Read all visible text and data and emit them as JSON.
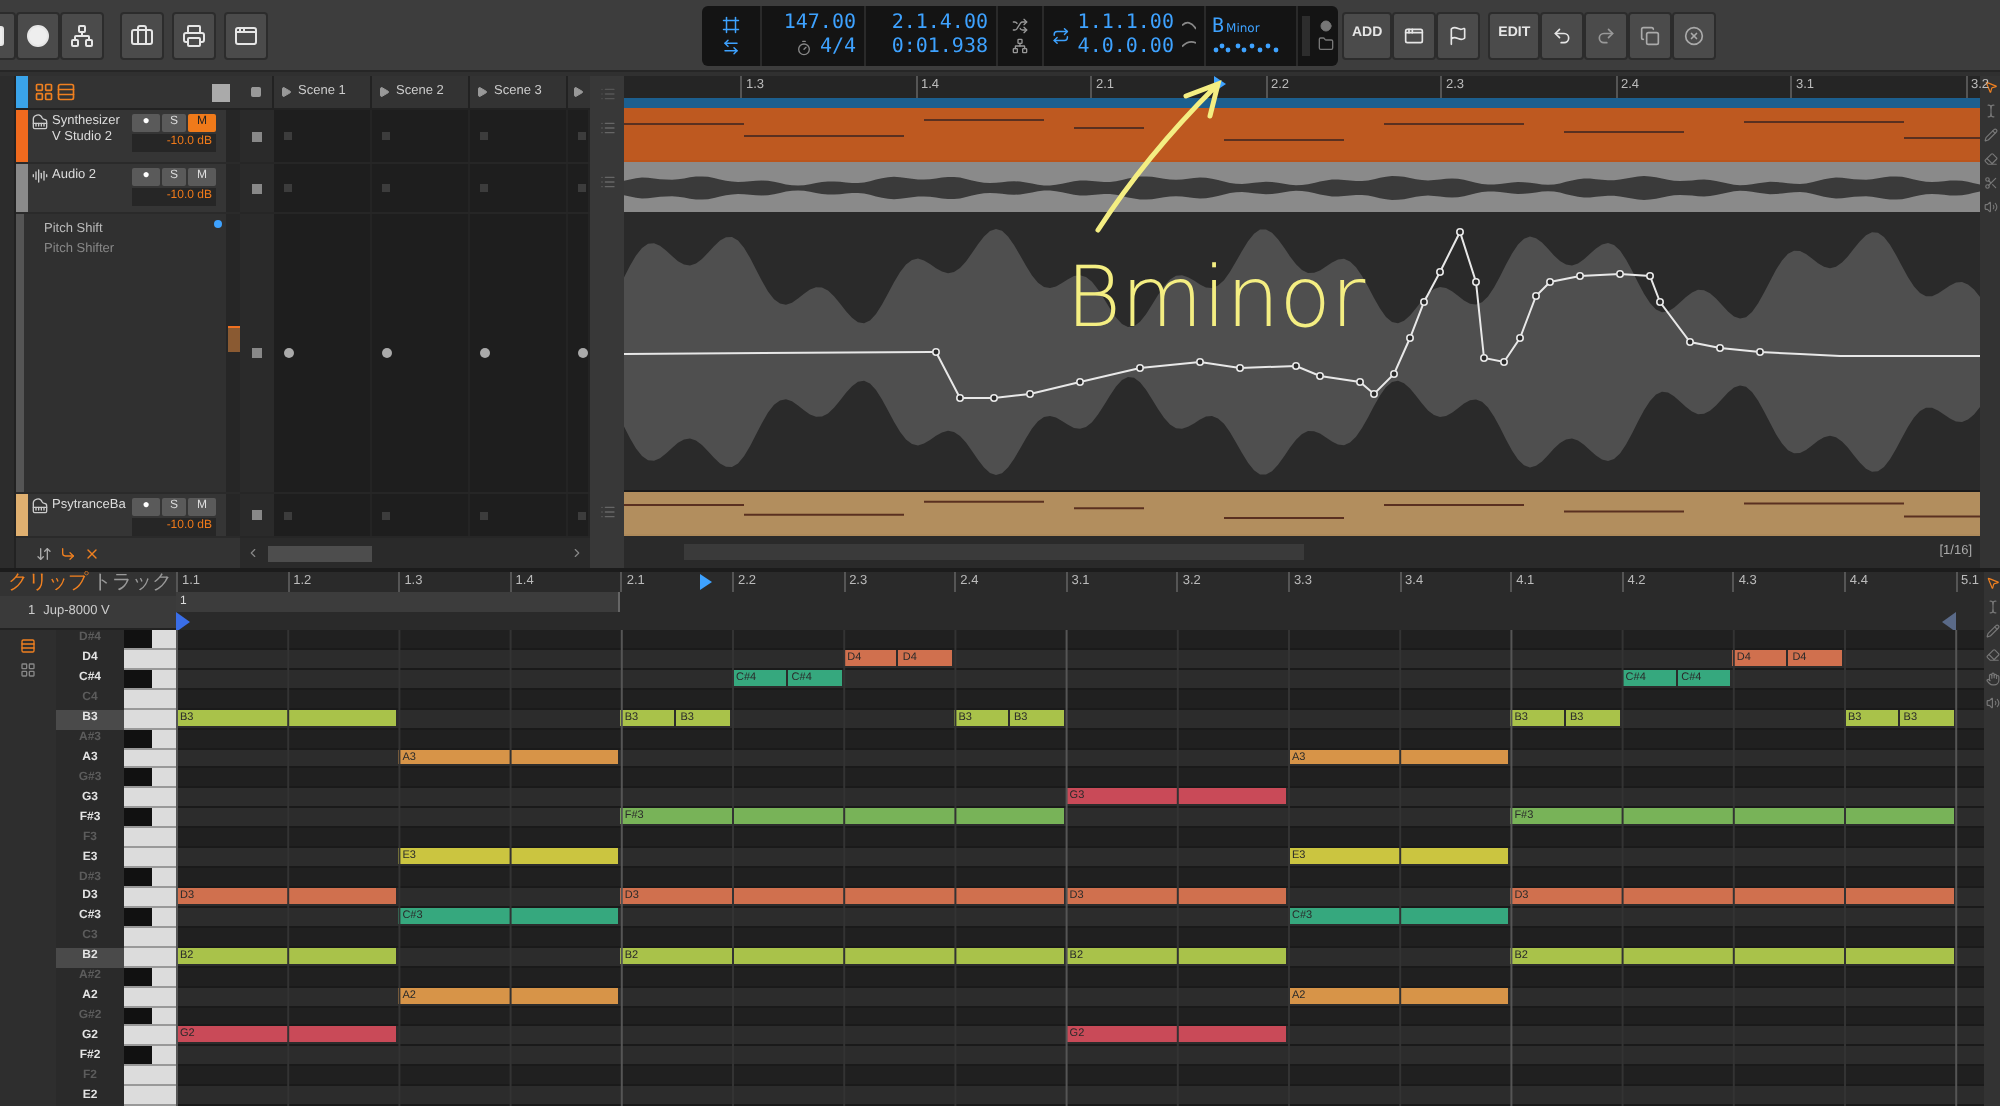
{
  "transport": {
    "tempo": "147.00",
    "time_signature": "4/4",
    "position_beats": "2.1.4.00",
    "position_time": "0:01.938",
    "loop_start": "1.1.1.00",
    "loop_length": "4.0.0.00",
    "key_root": "B",
    "key_scale": "Minor"
  },
  "toolbar": {
    "add_label": "ADD",
    "edit_label": "EDIT"
  },
  "scenes": [
    "Scene 1",
    "Scene 2",
    "Scene 3"
  ],
  "tracks": [
    {
      "kind": "instrument",
      "name": "Synthesizer V Studio 2",
      "color": "#f06a1e",
      "arm": "●",
      "solo": "S",
      "mute": "M",
      "muted": true,
      "volume": "-10.0 dB"
    },
    {
      "kind": "audio",
      "name": "Audio 2",
      "color": "#8a8a8a",
      "arm": "●",
      "solo": "S",
      "mute": "M",
      "muted": false,
      "volume": "-10.0 dB"
    },
    {
      "kind": "device",
      "name": "Pitch Shift",
      "subtitle": "Pitch Shifter"
    },
    {
      "kind": "instrument",
      "name": "PsytranceBa",
      "color": "#e0b070",
      "arm": "●",
      "solo": "S",
      "mute": "M",
      "muted": false,
      "volume": "-10.0 dB"
    }
  ],
  "arranger_ruler": [
    "1.3",
    "1.4",
    "2.1",
    "2.2",
    "2.3",
    "2.4",
    "3.1",
    "3.2"
  ],
  "grid_readout": "[1/16]",
  "annotation": "Bminor",
  "editor": {
    "tabs": [
      {
        "label": "クリップ",
        "selected": true
      },
      {
        "label": "トラック",
        "selected": false
      }
    ],
    "clip_number": "1",
    "clip_name": "Jup-8000 V",
    "clip_marker": "1",
    "ruler": [
      "1.1",
      "1.2",
      "1.3",
      "1.4",
      "2.1",
      "2.2",
      "2.3",
      "2.4",
      "3.1",
      "3.2",
      "3.3",
      "3.4",
      "4.1",
      "4.2",
      "4.3",
      "4.4",
      "5.1"
    ],
    "keys": [
      {
        "label": "D#4",
        "black": true,
        "in_scale": false,
        "root": false
      },
      {
        "label": "D4",
        "black": false,
        "in_scale": true,
        "root": false,
        "notes": [
          {
            "label": "D4",
            "color": "#d0704e"
          },
          {
            "label": "D4",
            "color": "#d0704e"
          },
          {
            "label": "D4",
            "color": "#d0704e"
          },
          {
            "label": "D4",
            "color": "#d0704e"
          }
        ]
      },
      {
        "label": "C#4",
        "black": true,
        "in_scale": true,
        "root": false,
        "notes": [
          {
            "label": "C#4",
            "color": "#36a87e"
          },
          {
            "label": "C#4",
            "color": "#36a87e"
          },
          {
            "label": "C#4",
            "color": "#36a87e"
          },
          {
            "label": "C#4",
            "color": "#36a87e"
          }
        ]
      },
      {
        "label": "C4",
        "black": false,
        "in_scale": false,
        "root": false
      },
      {
        "label": "B3",
        "black": false,
        "in_scale": true,
        "root": true,
        "notes": [
          {
            "label": "B3",
            "color": "#a9c24a"
          },
          {
            "label": "B3",
            "color": "#a9c24a"
          },
          {
            "label": "B3",
            "color": "#a9c24a"
          },
          {
            "label": "B3",
            "color": "#a9c24a"
          },
          {
            "label": "B3",
            "color": "#a9c24a"
          },
          {
            "label": "B3",
            "color": "#a9c24a"
          },
          {
            "label": "B3",
            "color": "#a9c24a"
          },
          {
            "label": "B3",
            "color": "#a9c24a"
          },
          {
            "label": "B3",
            "color": "#a9c24a"
          }
        ]
      },
      {
        "label": "A#3",
        "black": true,
        "in_scale": false,
        "root": false
      },
      {
        "label": "A3",
        "black": false,
        "in_scale": true,
        "root": false,
        "notes": [
          {
            "label": "A3",
            "color": "#d79448"
          },
          {
            "label": "A3",
            "color": "#d79448"
          }
        ]
      },
      {
        "label": "G#3",
        "black": true,
        "in_scale": false,
        "root": false
      },
      {
        "label": "G3",
        "black": false,
        "in_scale": true,
        "root": false,
        "notes": [
          {
            "label": "G3",
            "color": "#c94a58"
          }
        ]
      },
      {
        "label": "F#3",
        "black": true,
        "in_scale": true,
        "root": false,
        "notes": [
          {
            "label": "F#3",
            "color": "#78b358"
          },
          {
            "label": "F#3",
            "color": "#78b358"
          }
        ]
      },
      {
        "label": "F3",
        "black": false,
        "in_scale": false,
        "root": false
      },
      {
        "label": "E3",
        "black": false,
        "in_scale": true,
        "root": false,
        "notes": [
          {
            "label": "E3",
            "color": "#cbc540"
          },
          {
            "label": "E3",
            "color": "#cbc540"
          }
        ]
      },
      {
        "label": "D#3",
        "black": true,
        "in_scale": false,
        "root": false
      },
      {
        "label": "D3",
        "black": false,
        "in_scale": true,
        "root": false,
        "notes": [
          {
            "label": "D3",
            "color": "#d0704e"
          },
          {
            "label": "D3",
            "color": "#d0704e"
          },
          {
            "label": "D3",
            "color": "#d0704e"
          },
          {
            "label": "D3",
            "color": "#d0704e"
          }
        ]
      },
      {
        "label": "C#3",
        "black": true,
        "in_scale": true,
        "root": false,
        "notes": [
          {
            "label": "C#3",
            "color": "#36a87e"
          },
          {
            "label": "C#3",
            "color": "#36a87e"
          }
        ]
      },
      {
        "label": "C3",
        "black": false,
        "in_scale": false,
        "root": false
      },
      {
        "label": "B2",
        "black": false,
        "in_scale": true,
        "root": true,
        "notes": [
          {
            "label": "B2",
            "color": "#a9c24a"
          },
          {
            "label": "B2",
            "color": "#a9c24a"
          },
          {
            "label": "B2",
            "color": "#a9c24a"
          },
          {
            "label": "B2",
            "color": "#a9c24a"
          }
        ]
      },
      {
        "label": "A#2",
        "black": true,
        "in_scale": false,
        "root": false
      },
      {
        "label": "A2",
        "black": false,
        "in_scale": true,
        "root": false,
        "notes": [
          {
            "label": "A2",
            "color": "#d79448"
          },
          {
            "label": "A2",
            "color": "#d79448"
          }
        ]
      },
      {
        "label": "G#2",
        "black": true,
        "in_scale": false,
        "root": false
      },
      {
        "label": "G2",
        "black": false,
        "in_scale": true,
        "root": false,
        "notes": [
          {
            "label": "G2",
            "color": "#c94a58"
          },
          {
            "label": "G2",
            "color": "#c94a58"
          }
        ]
      },
      {
        "label": "F#2",
        "black": true,
        "in_scale": true,
        "root": false
      },
      {
        "label": "F2",
        "black": false,
        "in_scale": false,
        "root": false
      },
      {
        "label": "E2",
        "black": false,
        "in_scale": true,
        "root": false
      }
    ]
  }
}
